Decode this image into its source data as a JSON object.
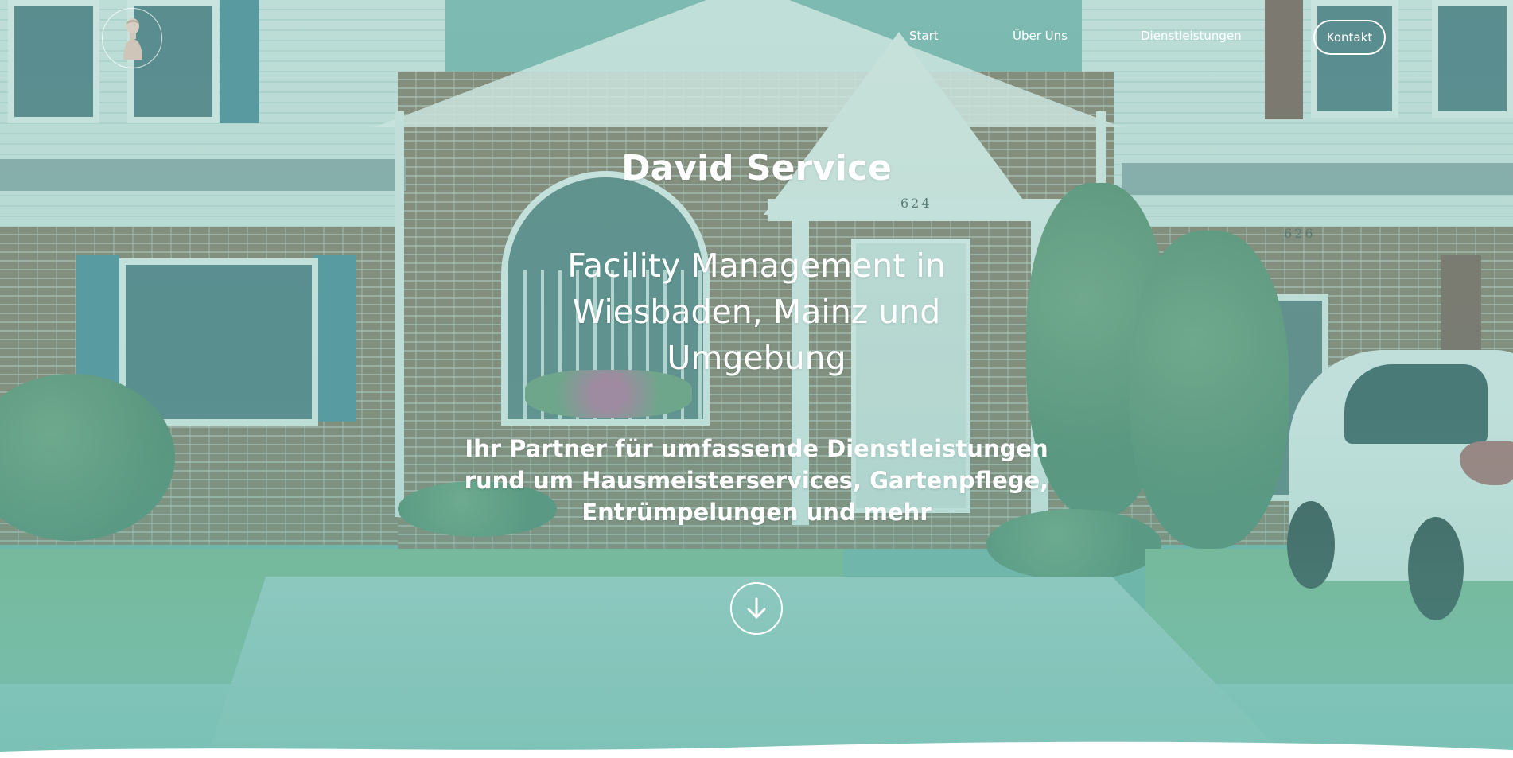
{
  "site": {
    "name": "David Service"
  },
  "nav": {
    "items": [
      {
        "label": "Start"
      },
      {
        "label": "Über Uns"
      },
      {
        "label": "Dienstleistungen"
      }
    ],
    "contact_label": "Kontakt"
  },
  "hero": {
    "title": "David Service",
    "subtitle": "Facility Management in Wiesbaden, Mainz und Umgebung",
    "tagline": "Ihr Partner für umfassende Dienstleistungen rund um Hausmeisterservices, Gartenpflege, Entrümpelungen und mehr",
    "house_numbers": [
      "624",
      "626"
    ]
  },
  "icons": {
    "logo": "bust-statue-icon",
    "scroll": "arrow-down-icon"
  },
  "colors": {
    "overlay_teal": "#6fb8ab",
    "text": "#ffffff",
    "page_bg": "#ffffff"
  }
}
